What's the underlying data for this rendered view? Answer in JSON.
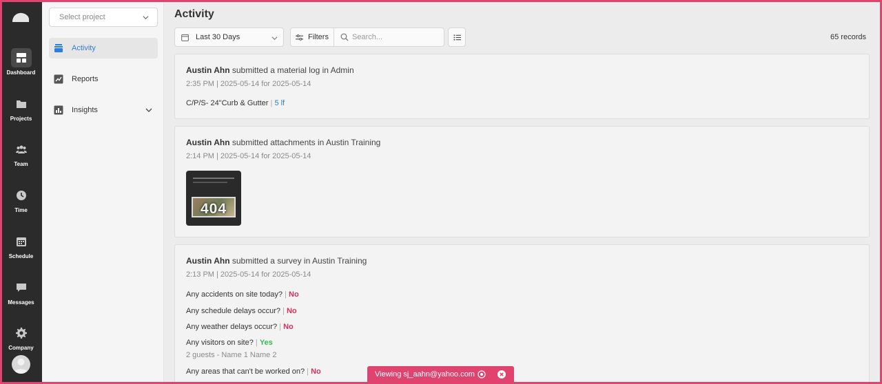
{
  "rail": {
    "items": [
      {
        "label": "Dashboard",
        "icon": "dashboard-icon",
        "active": true
      },
      {
        "label": "Projects",
        "icon": "folder-icon"
      },
      {
        "label": "Team",
        "icon": "team-icon"
      },
      {
        "label": "Time",
        "icon": "clock-icon"
      },
      {
        "label": "Schedule",
        "icon": "calendar-icon"
      },
      {
        "label": "Messages",
        "icon": "chat-icon"
      },
      {
        "label": "Company",
        "icon": "gear-icon"
      }
    ]
  },
  "side": {
    "select_placeholder": "Select project",
    "nav": [
      {
        "label": "Activity",
        "icon": "activity-icon",
        "active": true
      },
      {
        "label": "Reports",
        "icon": "reports-icon"
      },
      {
        "label": "Insights",
        "icon": "insights-icon"
      }
    ]
  },
  "main": {
    "title": "Activity",
    "date_range": "Last 30 Days",
    "filters_label": "Filters",
    "search_placeholder": "Search...",
    "records": "65 records"
  },
  "cards": [
    {
      "user": "Austin Ahn",
      "action": " submitted a material log in Admin",
      "meta": "2:35 PM | 2025-05-14 for 2025-05-14",
      "item": "C/P/S- 24\"Curb & Gutter",
      "sep": "|",
      "qty": "5 lf"
    },
    {
      "user": "Austin Ahn",
      "action": " submitted attachments in Austin Training",
      "meta": "2:14 PM | 2025-05-14 for 2025-05-14",
      "thumb_text": "404"
    },
    {
      "user": "Austin Ahn",
      "action": " submitted a survey in Austin Training",
      "meta": "2:13 PM | 2025-05-14 for 2025-05-14",
      "questions": [
        {
          "q": "Any accidents on site today?",
          "a": "No"
        },
        {
          "q": "Any schedule delays occur?",
          "a": "No"
        },
        {
          "q": "Any weather delays occur?",
          "a": "No"
        },
        {
          "q": "Any visitors on site?",
          "a": "Yes",
          "detail": "2 guests - Name 1 Name 2"
        },
        {
          "q": "Any areas that can't be worked on?",
          "a": "No"
        }
      ]
    }
  ],
  "toast": {
    "text": "Viewing sj_aahn@yahoo.com"
  },
  "colors": {
    "accent": "#2d7ed8",
    "no": "#d72f5a",
    "yes": "#3cba54",
    "banner": "#e0436e"
  }
}
